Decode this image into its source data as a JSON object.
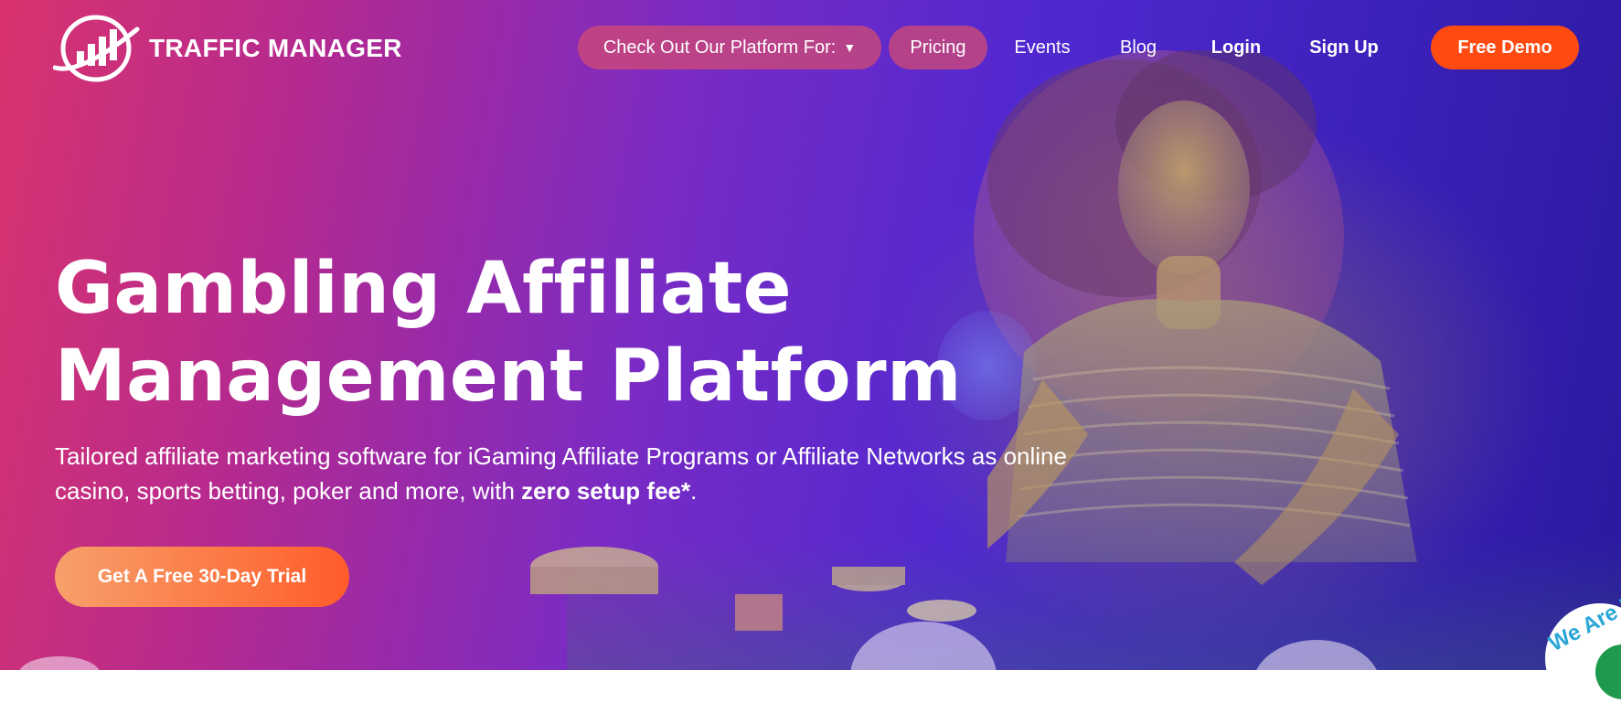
{
  "brand": {
    "name": "TRAFFIC MANAGER"
  },
  "nav": {
    "platform_label": "Check Out Our Platform For:",
    "pricing": "Pricing",
    "events": "Events",
    "blog": "Blog",
    "login": "Login",
    "signup": "Sign Up",
    "demo": "Free Demo"
  },
  "hero": {
    "headline_line1": "Gambling Affiliate",
    "headline_line2": "Management Platform",
    "subtext_part1": "Tailored affiliate marketing software for iGaming Affiliate Programs or Affiliate Networks as online casino, sports betting, poker and more, with ",
    "subtext_bold": "zero setup fee*",
    "subtext_end": ".",
    "cta": "Get A Free 30-Day Trial"
  },
  "badge": {
    "text": "We Are H"
  },
  "colors": {
    "accent_orange": "#ff4a12",
    "pill_pink": "#d24b73",
    "gradient_start": "#d9336e",
    "gradient_end": "#2a1a9e"
  },
  "icons": {
    "logo": "trend-chart-ring-logo-icon",
    "dropdown": "caret-down-icon"
  }
}
